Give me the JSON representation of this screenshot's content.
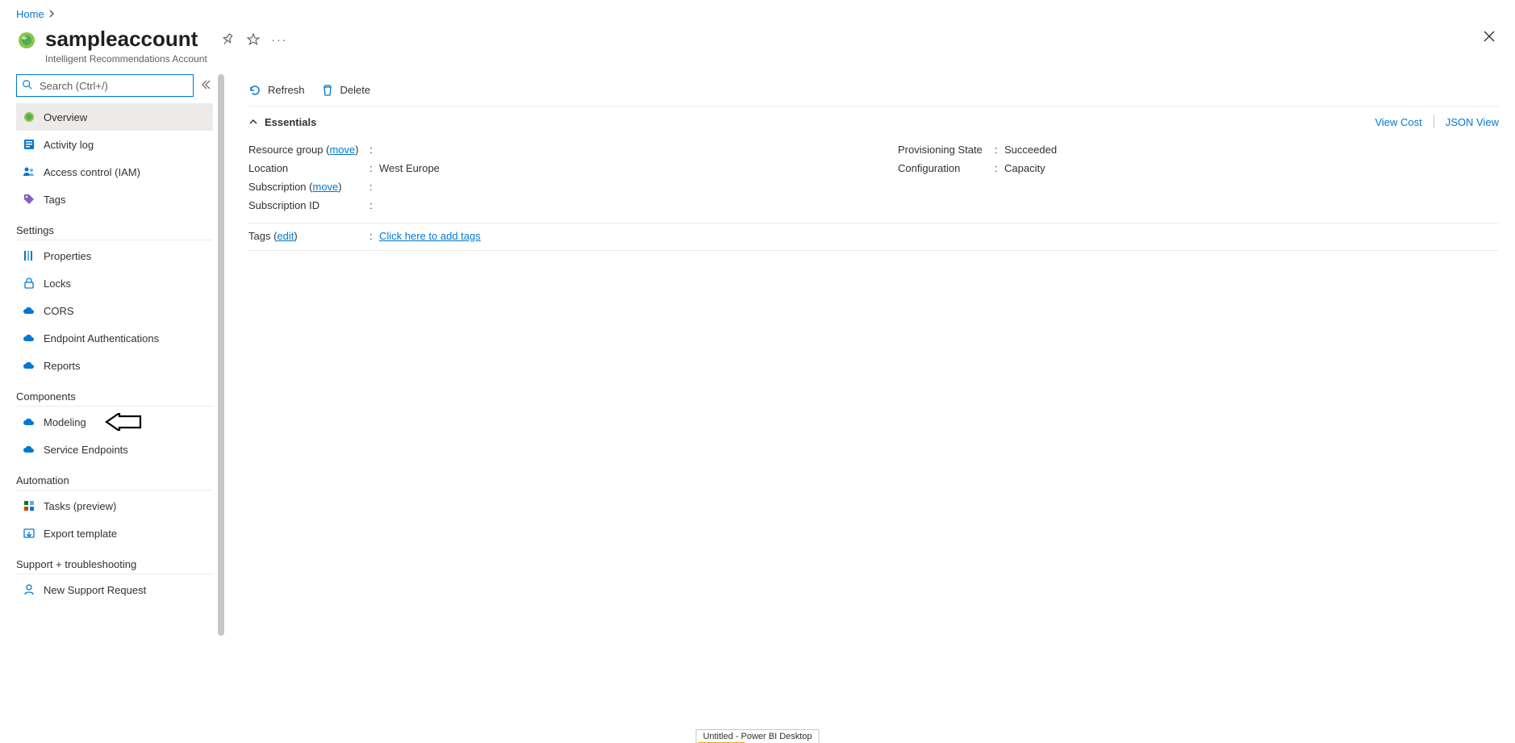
{
  "breadcrumb": {
    "home": "Home"
  },
  "header": {
    "title": "sampleaccount",
    "subtitle": "Intelligent Recommendations Account"
  },
  "search": {
    "placeholder": "Search (Ctrl+/)"
  },
  "nav": {
    "top": [
      {
        "id": "overview",
        "label": "Overview"
      },
      {
        "id": "activity-log",
        "label": "Activity log"
      },
      {
        "id": "access-control",
        "label": "Access control (IAM)"
      },
      {
        "id": "tags",
        "label": "Tags"
      }
    ],
    "sections": [
      {
        "title": "Settings",
        "items": [
          {
            "id": "properties",
            "label": "Properties"
          },
          {
            "id": "locks",
            "label": "Locks"
          },
          {
            "id": "cors",
            "label": "CORS"
          },
          {
            "id": "endpoint-auth",
            "label": "Endpoint Authentications"
          },
          {
            "id": "reports",
            "label": "Reports"
          }
        ]
      },
      {
        "title": "Components",
        "items": [
          {
            "id": "modeling",
            "label": "Modeling"
          },
          {
            "id": "service-endpoints",
            "label": "Service Endpoints"
          }
        ]
      },
      {
        "title": "Automation",
        "items": [
          {
            "id": "tasks",
            "label": "Tasks (preview)"
          },
          {
            "id": "export-template",
            "label": "Export template"
          }
        ]
      },
      {
        "title": "Support + troubleshooting",
        "items": [
          {
            "id": "new-support",
            "label": "New Support Request"
          }
        ]
      }
    ]
  },
  "toolbar": {
    "refresh": "Refresh",
    "delete": "Delete"
  },
  "essentials": {
    "title": "Essentials",
    "links": {
      "viewCost": "View Cost",
      "jsonView": "JSON View"
    },
    "left": {
      "resourceGroup": {
        "label": "Resource group",
        "moveText": "move",
        "value": ""
      },
      "location": {
        "label": "Location",
        "value": "West Europe"
      },
      "subscription": {
        "label": "Subscription",
        "moveText": "move",
        "value": ""
      },
      "subscriptionId": {
        "label": "Subscription ID",
        "value": ""
      }
    },
    "right": {
      "provisioningState": {
        "label": "Provisioning State",
        "value": "Succeeded"
      },
      "configuration": {
        "label": "Configuration",
        "value": "Capacity"
      }
    },
    "tags": {
      "label": "Tags",
      "editText": "edit",
      "addLink": "Click here to add tags"
    }
  },
  "taskbarChip": "Untitled - Power BI Desktop"
}
